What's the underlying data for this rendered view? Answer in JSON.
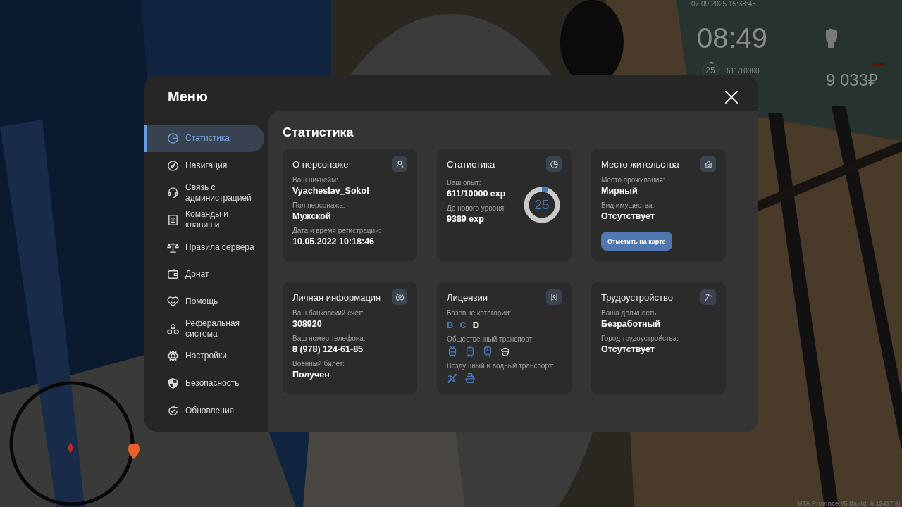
{
  "hud": {
    "timestamp": "07.09.2025 15:38:45",
    "clock": "08:49",
    "level": "25",
    "exp": "611/10000",
    "money": "9 033₽",
    "build": "MTA Province #5 (build: 6.12417.9)"
  },
  "menu": {
    "title": "Меню",
    "sidebar": {
      "items": [
        {
          "label": "Статистика",
          "selected": true
        },
        {
          "label": "Навигация",
          "selected": false
        },
        {
          "label": "Связь с администрацией",
          "selected": false
        },
        {
          "label": "Команды и клавиши",
          "selected": false
        },
        {
          "label": "Правила сервера",
          "selected": false
        },
        {
          "label": "Донат",
          "selected": false
        },
        {
          "label": "Помощь",
          "selected": false
        },
        {
          "label": "Реферальная система",
          "selected": false
        },
        {
          "label": "Настройки",
          "selected": false
        },
        {
          "label": "Безопасность",
          "selected": false
        },
        {
          "label": "Обновления",
          "selected": false
        }
      ]
    },
    "section_title": "Статистика",
    "cards": [
      {
        "kind": "info",
        "title": "О персонаже",
        "fields": [
          {
            "label": "Ваш никнейм:",
            "value": "Vyacheslav_Sokol"
          },
          {
            "label": "Пол персонажа:",
            "value": "Мужской"
          },
          {
            "label": "Дата и время регистрации:",
            "value": "10.05.2022 10:18:46"
          }
        ]
      },
      {
        "kind": "stats",
        "title": "Статистика",
        "fields": [
          {
            "label": "Ваш опыт:",
            "value": "611/10000 exp"
          },
          {
            "label": "До нового уровня:",
            "value": "9389 exp"
          }
        ],
        "ring": {
          "label": "25"
        }
      },
      {
        "kind": "info",
        "title": "Место жительства",
        "fields": [
          {
            "label": "Место проживания:",
            "value": "Мирный"
          },
          {
            "label": "Вид имущества:",
            "value": "Отсутствует"
          }
        ],
        "button": "Отметить на карте"
      },
      {
        "kind": "info",
        "title": "Личная информация",
        "fields": [
          {
            "label": "Ваш банковский счет:",
            "value": "308920"
          },
          {
            "label": "Ваш номер телефона:",
            "value": "8 (978) 124-61-85"
          },
          {
            "label": "Военный билет:",
            "value": "Получен"
          }
        ]
      },
      {
        "kind": "licenses",
        "title": "Лицензии",
        "groups": [
          {
            "label": "Базовые категории:",
            "kind": "letters",
            "items": [
              {
                "letter": "B",
                "active": false
              },
              {
                "letter": "C",
                "active": false
              },
              {
                "letter": "D",
                "active": true
              }
            ]
          },
          {
            "label": "Общественный транспорт:",
            "kind": "icons",
            "items": [
              {
                "kind": "trolleybus",
                "active": false
              },
              {
                "kind": "tram",
                "active": false
              },
              {
                "kind": "train",
                "active": false
              },
              {
                "kind": "captain",
                "active": true
              }
            ]
          },
          {
            "label": "Воздушный и водный транспорт:",
            "kind": "icons",
            "items": [
              {
                "kind": "plane",
                "active": false
              },
              {
                "kind": "ship",
                "active": false
              }
            ]
          }
        ]
      },
      {
        "kind": "info",
        "title": "Трудоустройство",
        "fields": [
          {
            "label": "Ваша должность:",
            "value": "Безработный"
          },
          {
            "label": "Город трудоустройства:",
            "value": "Отсутствует"
          }
        ]
      }
    ]
  }
}
